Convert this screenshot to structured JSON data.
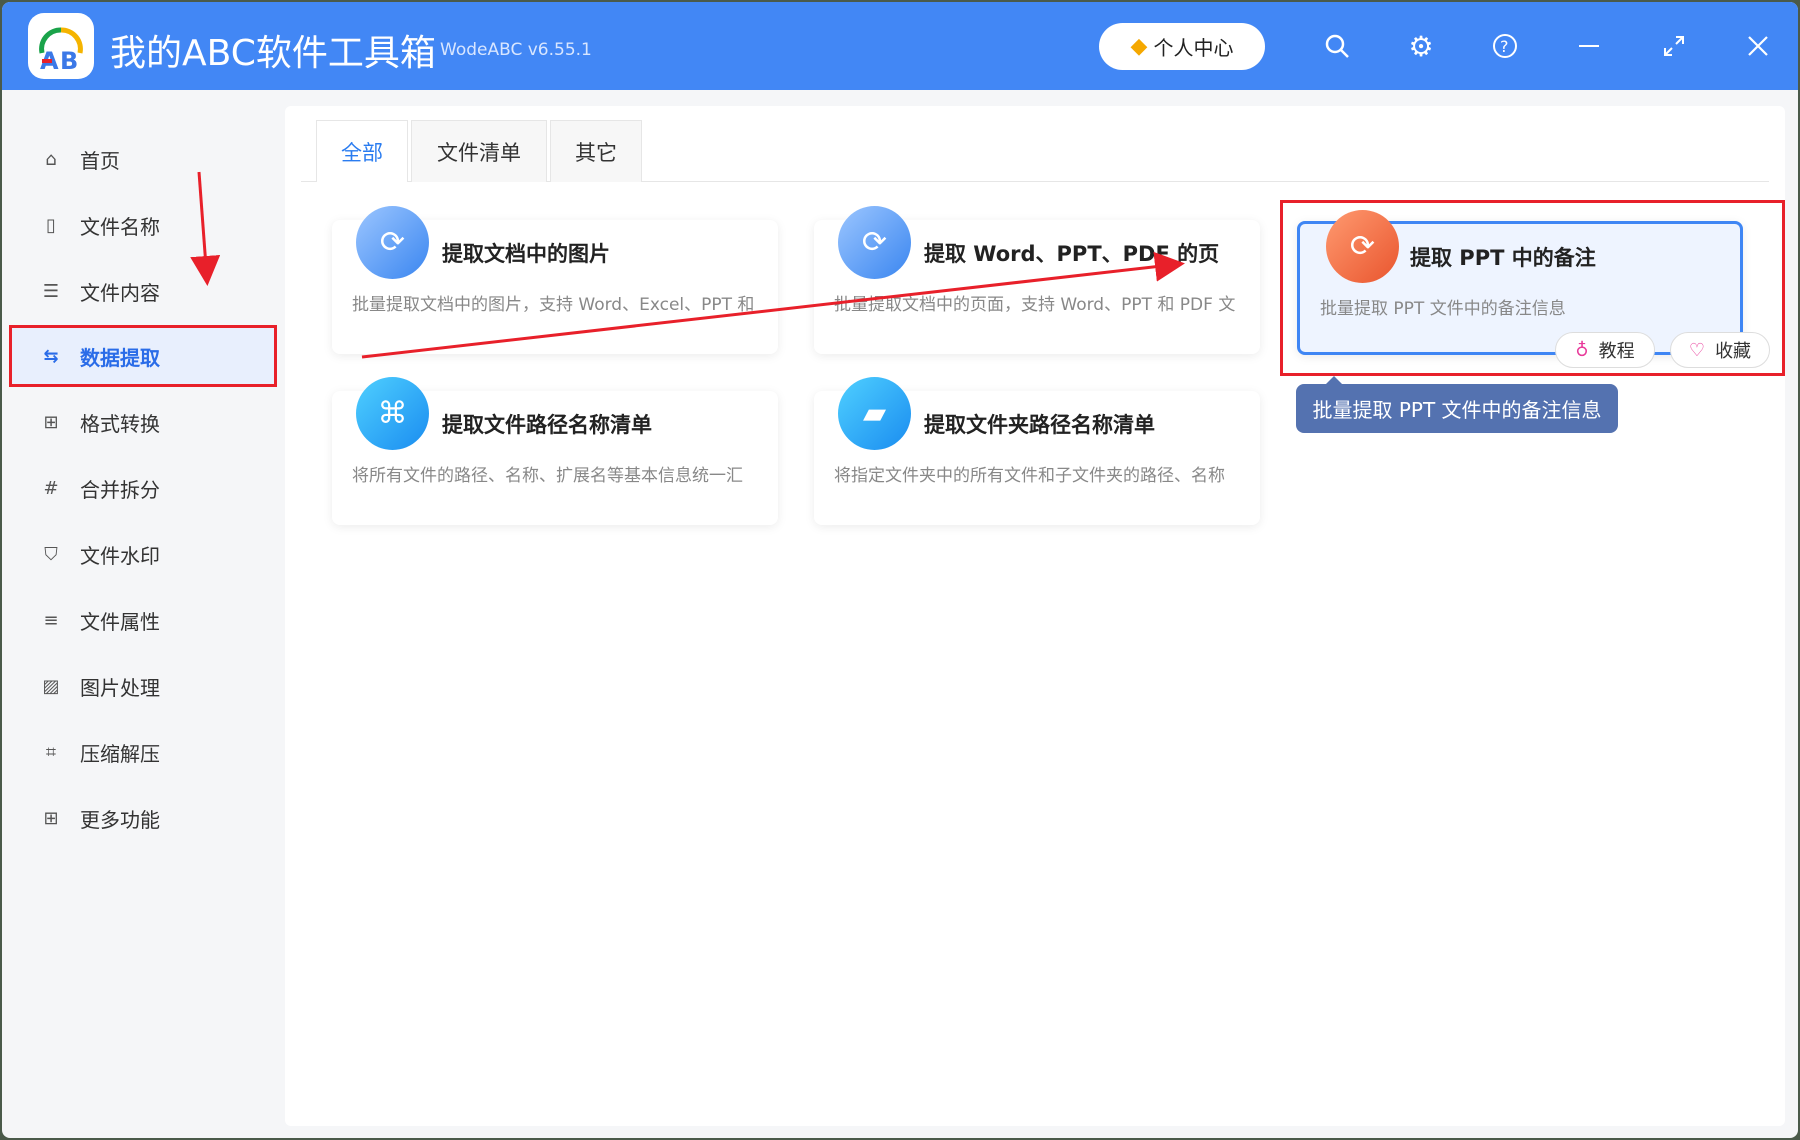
{
  "app": {
    "title": "我的ABC软件工具箱",
    "version": "WodeABC v6.55.1",
    "user_center": "个人中心"
  },
  "sidebar": {
    "items": [
      {
        "label": "首页",
        "icon": "home-icon"
      },
      {
        "label": "文件名称",
        "icon": "file-icon"
      },
      {
        "label": "文件内容",
        "icon": "content-icon"
      },
      {
        "label": "数据提取",
        "icon": "extract-icon"
      },
      {
        "label": "格式转换",
        "icon": "convert-icon"
      },
      {
        "label": "合并拆分",
        "icon": "hash-icon"
      },
      {
        "label": "文件水印",
        "icon": "shield-icon"
      },
      {
        "label": "文件属性",
        "icon": "list-icon"
      },
      {
        "label": "图片处理",
        "icon": "image-icon"
      },
      {
        "label": "压缩解压",
        "icon": "compress-icon"
      },
      {
        "label": "更多功能",
        "icon": "grid-icon"
      }
    ],
    "active": "数据提取"
  },
  "tabs": [
    "全部",
    "文件清单",
    "其它"
  ],
  "cards": [
    {
      "title": "提取文档中的图片",
      "desc": "批量提取文档中的图片，支持 Word、Excel、PPT 和"
    },
    {
      "title": "提取 Word、PPT、PDF 的页",
      "desc": "批量提取文档中的页面，支持 Word、PPT 和 PDF 文"
    },
    {
      "title": "提取 PPT 中的备注",
      "desc": "批量提取 PPT 文件中的备注信息"
    },
    {
      "title": "提取文件路径名称清单",
      "desc": "将所有文件的路径、名称、扩展名等基本信息统一汇"
    },
    {
      "title": "提取文件夹路径名称清单",
      "desc": "将指定文件夹中的所有文件和子文件夹的路径、名称"
    }
  ],
  "card_actions": {
    "tutorial": "教程",
    "favorite": "收藏"
  },
  "tooltip": "批量提取 PPT 文件中的备注信息",
  "colors": {
    "accent": "#4287f5",
    "highlight": "#e8202a"
  }
}
